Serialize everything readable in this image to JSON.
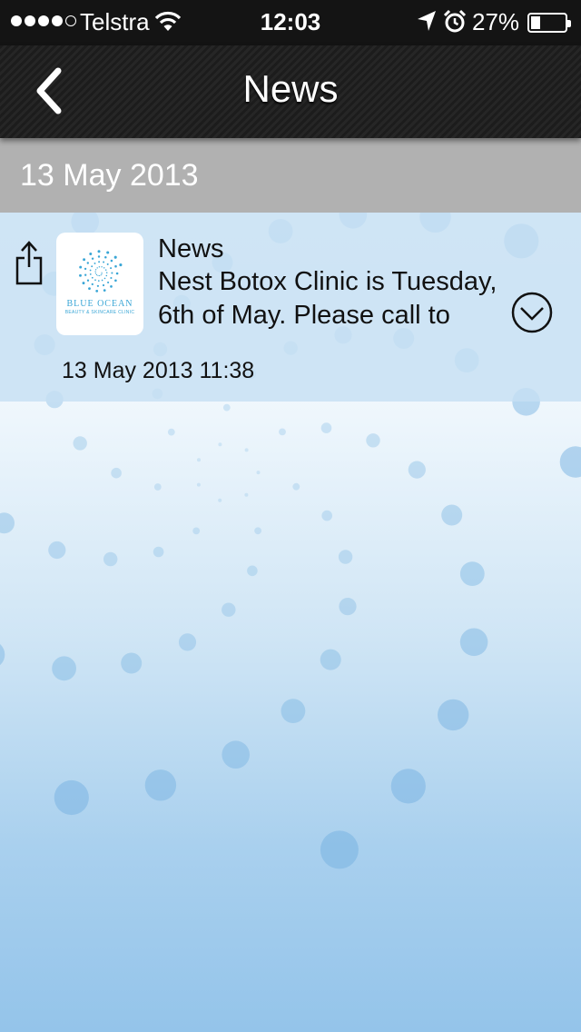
{
  "status_bar": {
    "carrier": "Telstra",
    "time": "12:03",
    "battery_percent": "27%",
    "battery_level": 0.27,
    "signal_bars": 4,
    "icons": [
      "signal-dots-icon",
      "wifi-icon",
      "location-arrow-icon",
      "alarm-clock-icon",
      "battery-icon"
    ]
  },
  "nav": {
    "title": "News",
    "back_icon": "chevron-left-icon"
  },
  "section": {
    "date": "13 May 2013"
  },
  "news_item": {
    "title": "News",
    "body": "Nest Botox Clinic is Tuesday, 6th of May. Please call to",
    "timestamp": "13 May 2013 11:38",
    "logo_brand": "BLUE OCEAN",
    "logo_tagline": "BEAUTY & SKINCARE CLINIC",
    "share_icon": "share-icon",
    "expand_icon": "chevron-down-circle-icon"
  },
  "colors": {
    "status_bar_bg": "#141414",
    "nav_bar_bg": "#1f1f1f",
    "section_header_bg": "#b1b1b1",
    "row_bg": "#c6dff3",
    "logo_accent": "#3aa6d6",
    "bubble": "#7db6e2"
  }
}
